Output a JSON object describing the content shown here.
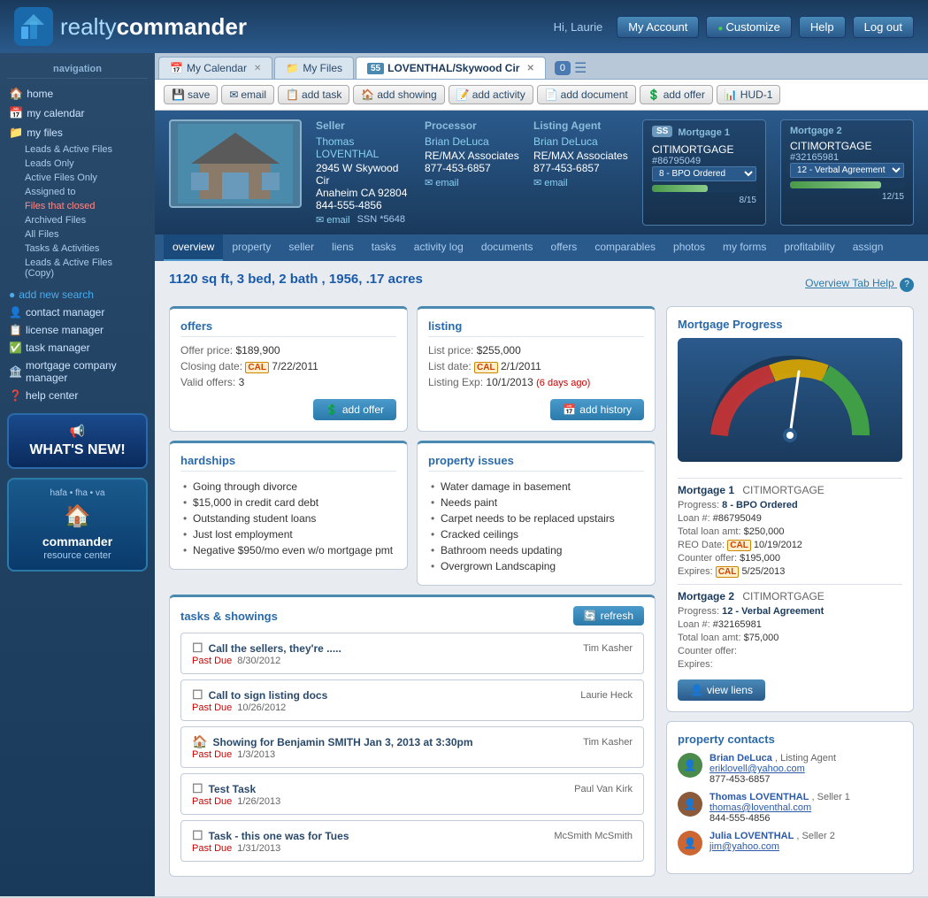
{
  "header": {
    "logo_text_part1": "realty",
    "logo_text_part2": "commander",
    "greeting": "Hi, Laurie",
    "my_account": "My Account",
    "customize": "Customize",
    "help": "Help",
    "log_out": "Log out"
  },
  "sidebar": {
    "nav_label": "navigation",
    "items": [
      {
        "id": "home",
        "label": "home",
        "icon": "🏠"
      },
      {
        "id": "my-calendar",
        "label": "my calendar",
        "icon": "📅"
      },
      {
        "id": "my-files",
        "label": "my files",
        "icon": "📁"
      }
    ],
    "sub_items": [
      "Leads & Active Files",
      "Leads Only",
      "Active Files Only",
      "Assigned to",
      "Files that closed",
      "Archived Files",
      "All Files",
      "Tasks & Activities",
      "Leads & Active Files (Copy)"
    ],
    "add_new_search": "add new search",
    "contact_manager": "contact manager",
    "license_manager": "license manager",
    "task_manager": "task manager",
    "mortgage_company_manager": "mortgage company manager",
    "help_center": "help center",
    "whats_new": "WHAT'S NEW!",
    "resource_center_line1": "hafa • fha • va",
    "resource_center_line2": "commander",
    "resource_center_line3": "resource center"
  },
  "tabs": [
    {
      "id": "calendar",
      "label": "My Calendar",
      "icon": "📅",
      "closable": true
    },
    {
      "id": "files",
      "label": "My Files",
      "icon": "📁",
      "closable": false
    },
    {
      "id": "loventhal",
      "label": "LOVENTHAL/Skywood Cir",
      "icon": "55",
      "closable": true,
      "active": true
    }
  ],
  "tab_counter": "0",
  "toolbar": {
    "save": "save",
    "email": "email",
    "add_task": "add task",
    "add_showing": "add showing",
    "add_activity": "add activity",
    "add_document": "add document",
    "add_offer": "add offer",
    "hud1": "HUD-1"
  },
  "property": {
    "title": "1120 sq ft, 3 bed, 2 bath , 1956, .17 acres",
    "overview_tab_help": "Overview Tab Help",
    "seller_label": "Seller",
    "seller_name": "Thomas LOVENTHAL",
    "seller_address": "2945 W Skywood Cir",
    "seller_city": "Anaheim CA 92804",
    "seller_phone": "844-555-4856",
    "seller_email": "email",
    "seller_ssn": "SSN *5648",
    "processor_label": "Processor",
    "processor_name": "Brian DeLuca",
    "processor_company": "RE/MAX Associates",
    "processor_phone": "877-453-6857",
    "processor_email": "email",
    "listing_agent_label": "Listing Agent",
    "listing_agent_name": "Brian DeLuca",
    "listing_agent_company": "RE/MAX Associates",
    "listing_agent_phone": "877-453-6857",
    "listing_agent_email": "email",
    "mortgage1_label": "Mortgage 1",
    "mortgage1_lender": "CITIMORTGAGE",
    "mortgage1_number": "#86795049",
    "mortgage1_status": "8 - BPO Ordered",
    "mortgage1_progress": "8/15",
    "mortgage1_progress_pct": 53,
    "mortgage2_label": "Mortgage 2",
    "mortgage2_lender": "CITIMORTGAGE",
    "mortgage2_number": "#32165981",
    "mortgage2_status": "12 - Verbal Agreement",
    "mortgage2_progress": "12/15",
    "mortgage2_progress_pct": 80
  },
  "subnav": [
    "overview",
    "property",
    "seller",
    "liens",
    "tasks",
    "activity log",
    "documents",
    "offers",
    "comparables",
    "photos",
    "my forms",
    "profitability",
    "assign"
  ],
  "overview": {
    "offers": {
      "title": "offers",
      "offer_price_label": "Offer price:",
      "offer_price": "$189,900",
      "closing_date_label": "Closing date:",
      "closing_date": "7/22/2011",
      "valid_offers_label": "Valid offers:",
      "valid_offers": "3",
      "add_offer_btn": "add offer"
    },
    "listing": {
      "title": "listing",
      "list_price_label": "List price:",
      "list_price": "$255,000",
      "list_date_label": "List date:",
      "list_date": "2/1/2011",
      "listing_exp_label": "Listing Exp:",
      "listing_exp": "10/1/2013",
      "listing_exp_note": "(6 days ago)",
      "add_history_btn": "add history"
    },
    "hardships": {
      "title": "hardships",
      "items": [
        "Going through divorce",
        "$15,000 in credit card debt",
        "Outstanding student loans",
        "Just lost employment",
        "Negative $950/mo even w/o mortgage pmt"
      ]
    },
    "property_issues": {
      "title": "property issues",
      "items": [
        "Water damage in basement",
        "Needs paint",
        "Carpet needs to be replaced upstairs",
        "Cracked ceilings",
        "Bathroom needs updating",
        "Overgrown Landscaping"
      ]
    },
    "tasks_showings": {
      "title": "tasks & showings",
      "refresh_btn": "refresh",
      "items": [
        {
          "type": "task",
          "name": "Call the sellers, they're .....",
          "due_label": "Past Due",
          "due_date": "8/30/2012",
          "assignee": "Tim Kasher"
        },
        {
          "type": "task",
          "name": "Call to sign listing docs",
          "due_label": "Past Due",
          "due_date": "10/26/2012",
          "assignee": "Laurie Heck"
        },
        {
          "type": "showing",
          "name": "Showing for Benjamin SMITH Jan 3, 2013 at 3:30pm",
          "due_label": "Past Due",
          "due_date": "1/3/2013",
          "assignee": "Tim Kasher"
        },
        {
          "type": "task",
          "name": "Test Task",
          "due_label": "Past Due",
          "due_date": "1/26/2013",
          "assignee": "Paul Van Kirk"
        },
        {
          "type": "task",
          "name": "Task - this one was for Tues",
          "due_label": "Past Due",
          "due_date": "1/31/2013",
          "assignee": "McSmith McSmith"
        }
      ]
    }
  },
  "mortgage_progress": {
    "title": "Mortgage Progress",
    "mortgage1": {
      "label": "Mortgage 1",
      "lender": "CITIMORTGAGE",
      "progress_label": "Progress:",
      "progress_value": "8 - BPO Ordered",
      "loan_label": "Loan #:",
      "loan_value": "#86795049",
      "total_loan_label": "Total loan amt:",
      "total_loan_value": "$250,000",
      "reo_label": "REO Date:",
      "reo_value": "10/19/2012",
      "counter_label": "Counter offer:",
      "counter_value": "$195,000",
      "expires_label": "Expires:",
      "expires_value": "5/25/2013"
    },
    "mortgage2": {
      "label": "Mortgage 2",
      "lender": "CITIMORTGAGE",
      "progress_label": "Progress:",
      "progress_value": "12 - Verbal Agreement",
      "loan_label": "Loan #:",
      "loan_value": "#32165981",
      "total_loan_label": "Total loan amt:",
      "total_loan_value": "$75,000",
      "counter_label": "Counter offer:",
      "counter_value": "",
      "expires_label": "Expires:",
      "expires_value": ""
    },
    "view_liens_btn": "view liens"
  },
  "property_contacts": {
    "title": "property contacts",
    "contacts": [
      {
        "name": "Brian DeLuca",
        "role": "Listing Agent",
        "email": "eriklovell@yahoo.com",
        "phone": "877-453-6857",
        "avatar_color": "#4a8a4a"
      },
      {
        "name": "Thomas LOVENTHAL",
        "role": "Seller 1",
        "email": "thomas@loventhal.com",
        "phone": "844-555-4856",
        "avatar_color": "#8a5a3a"
      },
      {
        "name": "Julia LOVENTHAL",
        "role": "Seller 2",
        "email": "jim@yahoo.com",
        "phone": "",
        "avatar_color": "#cc6633"
      }
    ]
  }
}
